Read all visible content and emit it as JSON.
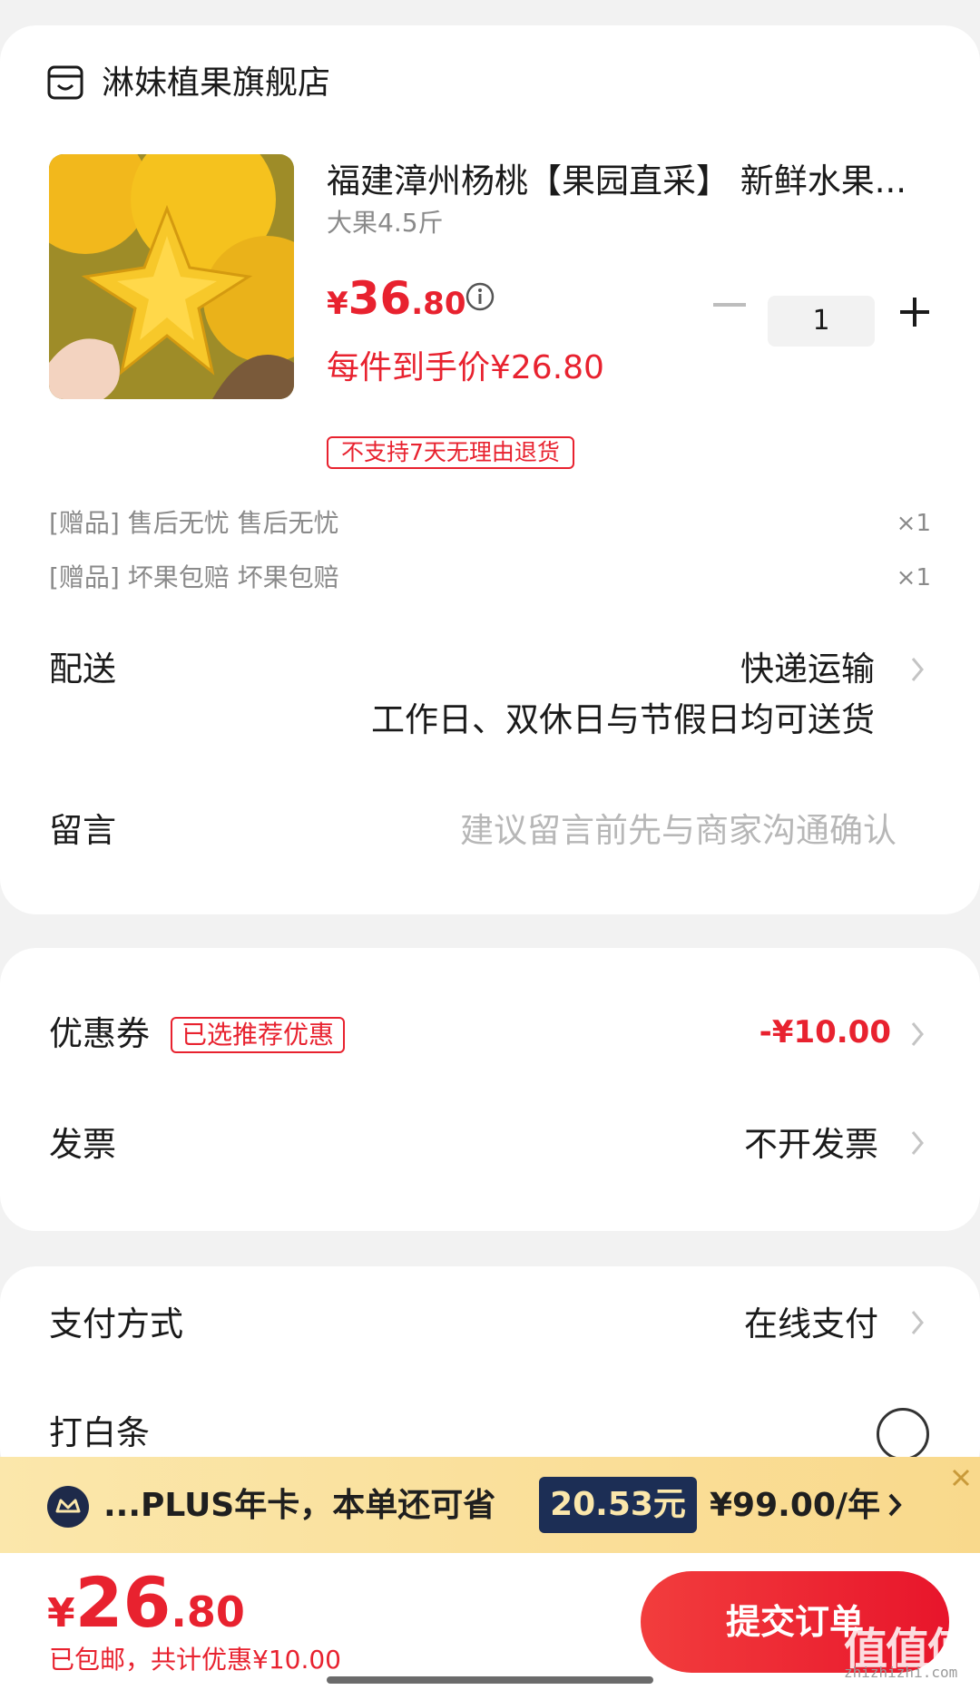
{
  "shop": {
    "name": "淋妹植果旗舰店",
    "icon": "shop-icon"
  },
  "product": {
    "title": "福建漳州杨桃【果园直采】 新鲜水果...",
    "spec": "大果4.5斤",
    "price_symbol": "¥",
    "price_int": "36",
    "price_dec": ".80",
    "net_price": "每件到手价¥26.80",
    "return_badge": "不支持7天无理由退货",
    "quantity": "1"
  },
  "gifts": [
    {
      "label": "[赠品]  售后无忧 售后无忧",
      "qty": "×1"
    },
    {
      "label": "[赠品]  坏果包赔 坏果包赔",
      "qty": "×1"
    }
  ],
  "delivery": {
    "label": "配送",
    "value": "快递运输",
    "note": "工作日、双休日与节假日均可送货"
  },
  "message": {
    "label": "留言",
    "placeholder": "建议留言前先与商家沟通确认"
  },
  "coupon": {
    "label": "优惠券",
    "badge": "已选推荐优惠",
    "value": "-¥10.00"
  },
  "invoice": {
    "label": "发票",
    "value": "不开发票"
  },
  "payment": {
    "label": "支付方式",
    "value": "在线支付"
  },
  "baitiao": {
    "label": "打白条"
  },
  "plus_banner": {
    "text": "...PLUS年卡，本单还可省",
    "save": "20.53元",
    "price": "¥99.00/年"
  },
  "bottom": {
    "total_symbol": "¥",
    "total_int": "26",
    "total_dec": ".80",
    "note": "已包邮，共计优惠¥10.00",
    "submit": "提交订单"
  },
  "watermark": {
    "text": "值值值",
    "url": "zhizhizhi.com"
  },
  "colors": {
    "accent": "#e8222f",
    "plus_bg": "#fbe7ab",
    "plus_dark": "#1c2e55"
  }
}
